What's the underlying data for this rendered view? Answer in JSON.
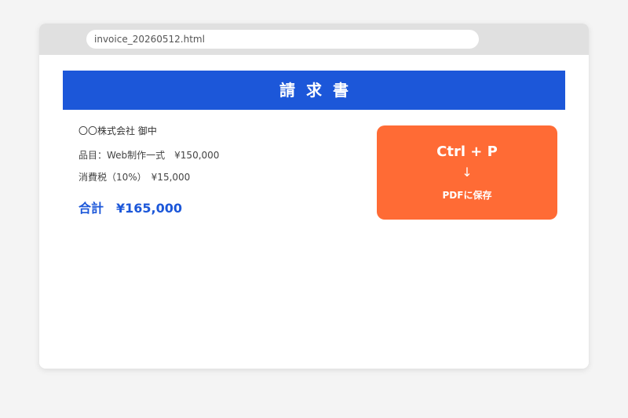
{
  "browser": {
    "url": "invoice_20260512.html"
  },
  "invoice": {
    "title": "請求書",
    "recipient": "〇〇株式会社 御中",
    "item_line": "品目：Web制作一式　¥150,000",
    "tax_line": "消費税（10%）　¥15,000",
    "total_line": "合計　¥165,000"
  },
  "shortcut": {
    "keys": "Ctrl + P",
    "arrow": "↓",
    "label": "PDFに保存"
  },
  "colors": {
    "title_bar": "#1c57d9",
    "total_text": "#1c57d9",
    "shortcut_card": "#ff6b35",
    "browser_chrome": "#e0e0e0",
    "page_background": "#f4f4f4"
  }
}
